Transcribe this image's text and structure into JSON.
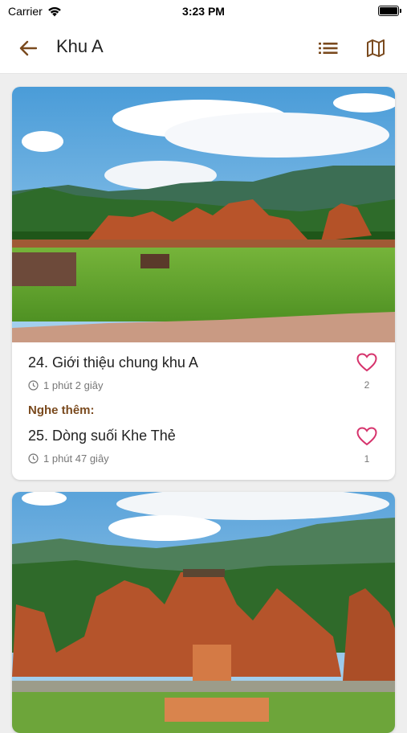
{
  "status_bar": {
    "carrier": "Carrier",
    "time": "3:23 PM"
  },
  "header": {
    "title": "Khu A",
    "back_icon": "arrow-left-icon",
    "list_icon": "list-icon",
    "map_icon": "map-icon"
  },
  "colors": {
    "accent": "#7a4a1e",
    "heart": "#d6336c"
  },
  "cards": [
    {
      "image": "temple-ruins-photo",
      "primary": {
        "title": "24. Giới thiệu chung khu A",
        "duration": "1 phút 2 giây",
        "likes": "2"
      },
      "more_label": "Nghe thêm:",
      "related": {
        "title": "25. Dòng suối Khe Thẻ",
        "duration": "1 phút 47 giây",
        "likes": "1"
      }
    },
    {
      "image": "temple-complex-photo"
    }
  ]
}
